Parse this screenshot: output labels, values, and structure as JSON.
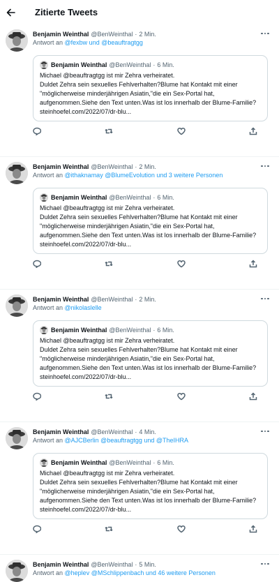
{
  "header": {
    "title": "Zitierte Tweets"
  },
  "tweets": [
    {
      "name": "Benjamin Weinthal",
      "handle": "@BenWeinthal",
      "dot": "·",
      "time": "2 Min.",
      "reply_prefix": "Antwort an ",
      "reply_targets": "@fexbw und @beauftragtgg",
      "quote": {
        "name": "Benjamin Weinthal",
        "handle": "@BenWeinthal",
        "dot": "·",
        "time": "6 Min.",
        "lines": [
          "Michael @beauftragtgg ist mir Zehra verheiratet.",
          "Duldet Zehra sein sexuelles Fehlverhalten?Blume hat Kontakt mit einer \"möglicherweise minderjährigen Asiatin,\"die ein Sex-Portal hat, aufgenommen.Siehe den Text unten.Was ist los innerhalb der Blume-Familie?",
          "steinhoefel.com/2022/07/dr-blu..."
        ]
      }
    },
    {
      "name": "Benjamin Weinthal",
      "handle": "@BenWeinthal",
      "dot": "·",
      "time": "2 Min.",
      "reply_prefix": "Antwort an ",
      "reply_targets": "@ithaknamay @BlumeEvolution und 3 weitere Personen",
      "quote": {
        "name": "Benjamin Weinthal",
        "handle": "@BenWeinthal",
        "dot": "·",
        "time": "6 Min.",
        "lines": [
          "Michael @beauftragtgg ist mir Zehra verheiratet.",
          "Duldet Zehra sein sexuelles Fehlverhalten?Blume hat Kontakt mit einer \"möglicherweise minderjährigen Asiatin,\"die ein Sex-Portal hat, aufgenommen.Siehe den Text unten.Was ist los innerhalb der Blume-Familie?",
          "steinhoefel.com/2022/07/dr-blu..."
        ]
      }
    },
    {
      "name": "Benjamin Weinthal",
      "handle": "@BenWeinthal",
      "dot": "·",
      "time": "2 Min.",
      "reply_prefix": "Antwort an ",
      "reply_targets": "@nikolaslelle",
      "quote": {
        "name": "Benjamin Weinthal",
        "handle": "@BenWeinthal",
        "dot": "·",
        "time": "6 Min.",
        "lines": [
          "Michael @beauftragtgg ist mir Zehra verheiratet.",
          "Duldet Zehra sein sexuelles Fehlverhalten?Blume hat Kontakt mit einer \"möglicherweise minderjährigen Asiatin,\"die ein Sex-Portal hat, aufgenommen.Siehe den Text unten.Was ist los innerhalb der Blume-Familie?",
          "steinhoefel.com/2022/07/dr-blu..."
        ]
      }
    },
    {
      "name": "Benjamin Weinthal",
      "handle": "@BenWeinthal",
      "dot": "·",
      "time": "4 Min.",
      "reply_prefix": "Antwort an ",
      "reply_targets": "@AJCBerlin @beauftragtgg und @TheIHRA",
      "quote": {
        "name": "Benjamin Weinthal",
        "handle": "@BenWeinthal",
        "dot": "·",
        "time": "6 Min.",
        "lines": [
          "Michael @beauftragtgg ist mir Zehra verheiratet.",
          "Duldet Zehra sein sexuelles Fehlverhalten?Blume hat Kontakt mit einer \"möglicherweise minderjährigen Asiatin,\"die ein Sex-Portal hat, aufgenommen.Siehe den Text unten.Was ist los innerhalb der Blume-Familie?",
          "steinhoefel.com/2022/07/dr-blu..."
        ]
      }
    },
    {
      "name": "Benjamin Weinthal",
      "handle": "@BenWeinthal",
      "dot": "·",
      "time": "5 Min.",
      "reply_prefix": "Antwort an ",
      "reply_targets": "@heplev @MSchlippenbach und 46 weitere Personen"
    }
  ],
  "icons": {
    "back": "arrow-left-icon",
    "more": "more-dots-icon",
    "reply": "reply-icon",
    "retweet": "retweet-icon",
    "like": "heart-icon",
    "share": "share-icon"
  },
  "colors": {
    "link": "#1d9bf0",
    "secondary": "#536471",
    "border": "#cfd9de"
  }
}
